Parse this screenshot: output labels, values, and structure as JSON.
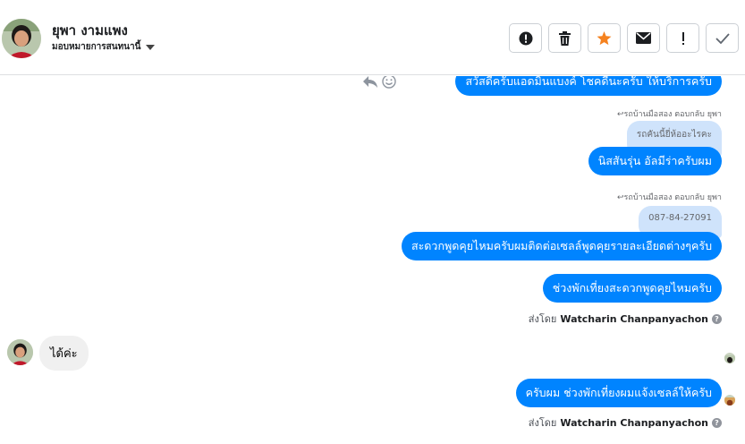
{
  "header": {
    "contact_name": "ยุพา งามแพง",
    "assign_label": "มอบหมายการสนทนานี้"
  },
  "actions": [
    {
      "name": "alert-icon"
    },
    {
      "name": "trash-icon"
    },
    {
      "name": "star-icon",
      "color": "#f5821f"
    },
    {
      "name": "envelope-icon"
    },
    {
      "name": "exclamation-icon"
    },
    {
      "name": "check-icon"
    }
  ],
  "messages": {
    "m1": "สวัสดีครับแอดมินแบงค์ โชคดีนะครับ ให้บริการครับ",
    "reply_label_1": "รถบ้านมือสอง ตอบกลับ ยุพา",
    "quote_1": "รถคันนี้ยี่ห้ออะไรคะ",
    "m2": "นิสสันรุ่น อัลมีร่าครับผม",
    "reply_label_2": "รถบ้านมือสอง ตอบกลับ ยุพา",
    "quote_2": "087-84-27091",
    "m3": "สะดวกพูดคุยไหมครับผมติดต่อเซลล์พูดคุยรายละเอียดต่างๆครับ",
    "m4": "ช่วงพักเที่ยงสะดวกพูดคุยไหมครับ",
    "sent_by_prefix_1": "ส่งโดย",
    "sent_by_name_1": "Watcharin Chanpanyachon",
    "incoming_1": "ได้ค่ะ",
    "m5": "ครับผม ช่วงพักเที่ยงผมแจ้งเซลล์ให้ครับ",
    "sent_by_prefix_2": "ส่งโดย",
    "sent_by_name_2": "Watcharin Chanpanyachon"
  },
  "colors": {
    "outgoing_bubble": "#0084ff",
    "quote_bubble": "#cfe3fb",
    "incoming_bubble": "#f0f0f0"
  }
}
